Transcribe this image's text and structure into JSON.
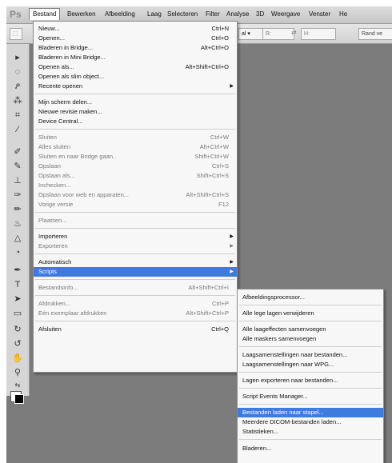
{
  "menubar": {
    "logo": "Ps",
    "items": [
      "Bestand",
      "Bewerken",
      "Afbeelding",
      "Laag",
      "Selecteren",
      "Filter",
      "Analyse",
      "3D",
      "Weergave",
      "Venster",
      "He"
    ]
  },
  "optionsbar": {
    "mode": "al",
    "field_r": "R:",
    "field_h": "H:",
    "button": "Rand ve"
  },
  "file_menu": [
    {
      "label": "Nieuw...",
      "shortcut": "Ctrl+N"
    },
    {
      "label": "Openen...",
      "shortcut": "Ctrl+O"
    },
    {
      "label": "Bladeren in Bridge...",
      "shortcut": "Alt+Ctrl+O"
    },
    {
      "label": "Bladeren in Mini Bridge...",
      "shortcut": ""
    },
    {
      "label": "Openen als...",
      "shortcut": "Alt+Shift+Ctrl+O"
    },
    {
      "label": "Openen als slim object...",
      "shortcut": ""
    },
    {
      "label": "Recente openen",
      "shortcut": ""
    },
    {
      "label": "Mijn scherm delen...",
      "shortcut": ""
    },
    {
      "label": "Nieuwe revisie maken...",
      "shortcut": ""
    },
    {
      "label": "Device Central...",
      "shortcut": ""
    },
    {
      "label": "Sluiten",
      "shortcut": "Ctrl+W"
    },
    {
      "label": "Alles sluiten",
      "shortcut": "Alt+Ctrl+W"
    },
    {
      "label": "Sluiten en naar Bridge gaan..",
      "shortcut": "Shift+Ctrl+W"
    },
    {
      "label": "Opslaan",
      "shortcut": "Ctrl+S"
    },
    {
      "label": "Opslaan als...",
      "shortcut": "Shift+Ctrl+S"
    },
    {
      "label": "Inchecken...",
      "shortcut": ""
    },
    {
      "label": "Opslaan voor web en apparaten...",
      "shortcut": "Alt+Shift+Ctrl+S"
    },
    {
      "label": "Vorige versie",
      "shortcut": "F12"
    },
    {
      "label": "Plaatsen...",
      "shortcut": ""
    },
    {
      "label": "Importeren",
      "shortcut": ""
    },
    {
      "label": "Exporteren",
      "shortcut": ""
    },
    {
      "label": "Automatisch",
      "shortcut": ""
    },
    {
      "label": "Scripts",
      "shortcut": ""
    },
    {
      "label": "Bestandsinfo...",
      "shortcut": "Alt+Shift+Ctrl+I"
    },
    {
      "label": "Afdrukken...",
      "shortcut": "Ctrl+P"
    },
    {
      "label": "Eén exemplaar afdrukken",
      "shortcut": "Alt+Shift+Ctrl+P"
    },
    {
      "label": "Afsluiten",
      "shortcut": "Ctrl+Q"
    }
  ],
  "scripts_menu": [
    "Afbeeldingsprocessor...",
    "Alle lege lagen verwijderen",
    "Alle laageffecten samenvoegen",
    "Alle maskers samenvoegen",
    "Laagsamenstellingen naar bestanden...",
    "Laagsamenstellingen naar WPG...",
    "Lagen exporteren naar bestanden...",
    "Script Events Manager...",
    "Bestanden laden naar stapel...",
    "Meerdere DICOM-bestanden laden...",
    "Statistieken...",
    "Bladeren..."
  ],
  "icons": {
    "submenu": "submenu-arrow-icon",
    "tools": [
      "marquee-icon",
      "move-icon",
      "lasso-icon",
      "quick-select-icon",
      "crop-icon",
      "eyedropper-icon",
      "healing-brush-icon",
      "brush-icon",
      "clone-stamp-icon",
      "history-brush-icon",
      "eraser-icon",
      "paint-bucket-icon",
      "blur-icon",
      "dodge-icon",
      "pen-icon",
      "type-icon",
      "path-select-icon",
      "shape-icon",
      "3d-rotate-icon",
      "3d-orbit-icon",
      "hand-icon",
      "zoom-icon",
      "swap-colors-icon",
      "color-swatches-icon",
      "quick-mask-icon"
    ]
  },
  "colors": {
    "highlight": "#3d7be0",
    "canvas": "#7c7c7c"
  }
}
